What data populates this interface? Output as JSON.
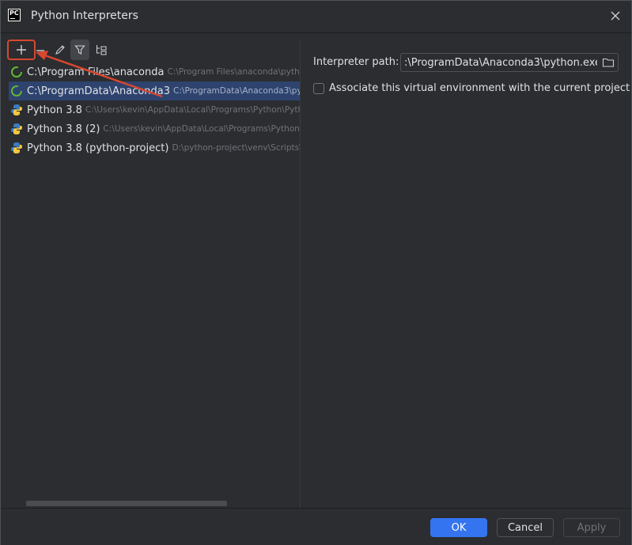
{
  "window": {
    "title": "Python Interpreters"
  },
  "toolbar": {
    "add": "add-interpreter",
    "remove": "remove-interpreter",
    "edit": "edit-interpreter",
    "filter": "filter-interpreters",
    "tree": "show-paths"
  },
  "interpreters": [
    {
      "name": "C:\\Program Files\\anaconda",
      "path": "C:\\Program Files\\anaconda\\pytho",
      "icon": "conda-icon",
      "selected": false
    },
    {
      "name": "C:\\ProgramData\\Anaconda3",
      "path": "C:\\ProgramData\\Anaconda3\\pyth",
      "icon": "conda-icon",
      "selected": true
    },
    {
      "name": "Python 3.8",
      "path": "C:\\Users\\kevin\\AppData\\Local\\Programs\\Python\\Pyth",
      "icon": "python-icon",
      "selected": false
    },
    {
      "name": "Python 3.8 (2)",
      "path": "C:\\Users\\kevin\\AppData\\Local\\Programs\\Python",
      "icon": "python-icon",
      "selected": false
    },
    {
      "name": "Python 3.8 (python-project)",
      "path": "D:\\python-project\\venv\\Scripts\\",
      "icon": "python-icon",
      "selected": false
    }
  ],
  "details": {
    "path_label": "Interpreter path:",
    "path_value": ":\\ProgramData\\Anaconda3\\python.exe",
    "associate_label": "Associate this virtual environment with the current project",
    "associate_checked": false
  },
  "buttons": {
    "ok": "OK",
    "cancel": "Cancel",
    "apply": "Apply"
  },
  "colors": {
    "accent": "#3574f0",
    "selection": "#2e436e",
    "annotation": "#d8472f"
  }
}
